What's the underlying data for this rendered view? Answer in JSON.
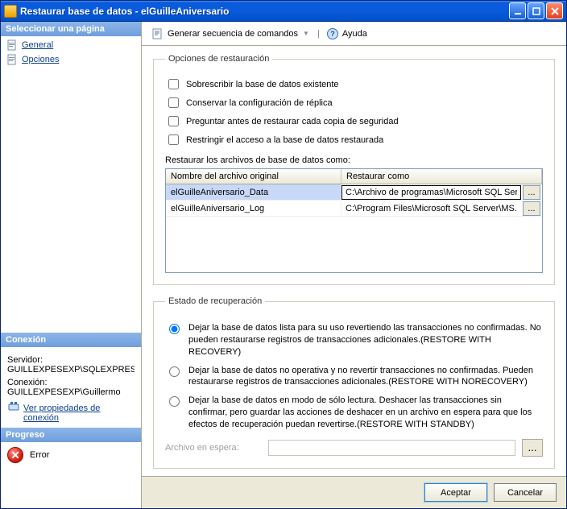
{
  "window": {
    "title": "Restaurar base de datos - elGuilleAniversario"
  },
  "sidebar": {
    "select_header": "Seleccionar una página",
    "pages": [
      {
        "label": "General"
      },
      {
        "label": "Opciones"
      }
    ],
    "connection_header": "Conexión",
    "server_label": "Servidor:",
    "server_value": "GUILLEXPESEXP\\SQLEXPRESS",
    "conn_label": "Conexión:",
    "conn_value": "GUILLEXPESEXP\\Guillermo",
    "view_link": "Ver propiedades de conexión",
    "progress_header": "Progreso",
    "progress_status": "Error"
  },
  "toolbar": {
    "script_label": "Generar secuencia de comandos",
    "help_label": "Ayuda"
  },
  "restore_options": {
    "group_title": "Opciones de restauración",
    "overwrite": "Sobrescribir la base de datos existente",
    "preserve": "Conservar la configuración de réplica",
    "prompt": "Preguntar antes de restaurar cada copia de seguridad",
    "restrict": "Restringir el acceso a la base de datos restaurada",
    "files_label": "Restaurar los archivos de base de datos como:",
    "col_original": "Nombre del archivo original",
    "col_restore_as": "Restaurar como",
    "rows": [
      {
        "original": "elGuilleAniversario_Data",
        "restore_as": "C:\\Archivo de programas\\Microsoft SQL Serv"
      },
      {
        "original": "elGuilleAniversario_Log",
        "restore_as": "C:\\Program Files\\Microsoft SQL Server\\MS..."
      }
    ]
  },
  "recovery": {
    "group_title": "Estado de recuperación",
    "opt_recovery": "Dejar la base de datos lista para su uso revertiendo las transacciones no confirmadas. No pueden restaurarse registros de transacciones adicionales.(RESTORE WITH RECOVERY)",
    "opt_norecovery": "Dejar la base de datos no operativa y no revertir transacciones no confirmadas. Pueden restaurarse registros de transacciones adicionales.(RESTORE WITH NORECOVERY)",
    "opt_standby": "Dejar la base de datos en modo de sólo lectura. Deshacer las transacciones sin confirmar, pero guardar las acciones de deshacer en un archivo en espera para que los efectos de recuperación puedan revertirse.(RESTORE WITH STANDBY)",
    "standby_label": "Archivo en espera:",
    "ellipsis": "..."
  },
  "buttons": {
    "ok": "Aceptar",
    "cancel": "Cancelar"
  }
}
